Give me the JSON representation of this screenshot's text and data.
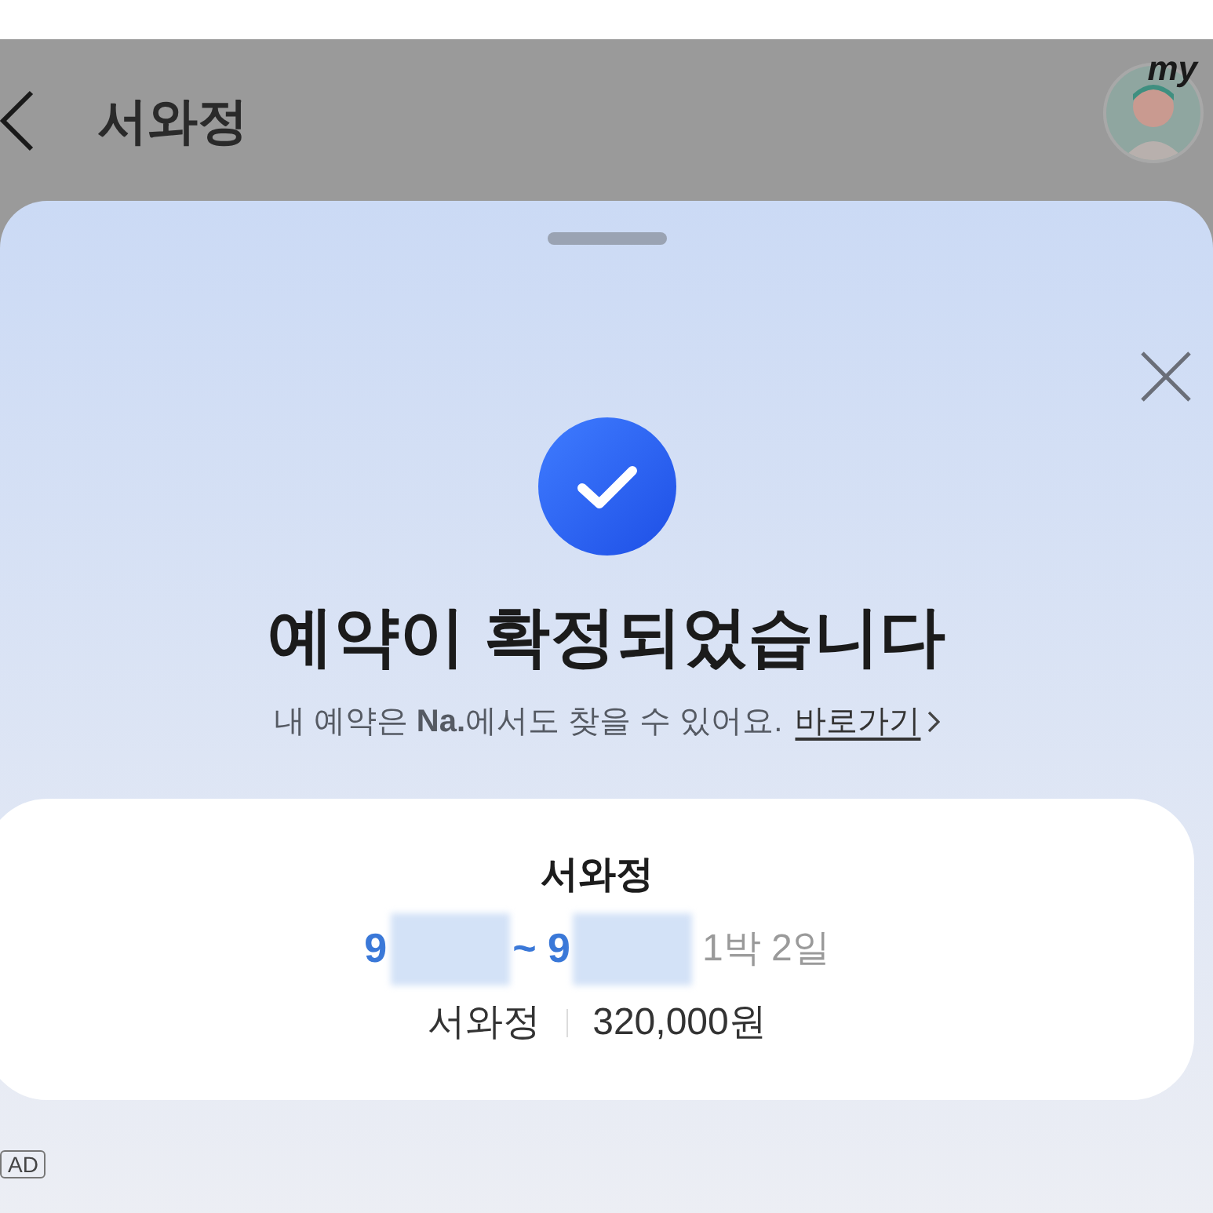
{
  "header": {
    "title": "서와정",
    "avatar_badge": "my"
  },
  "sheet": {
    "title": "예약이 확정되었습니다",
    "subtitle": "내 예약은 **Na.**에서도 찾을 수 있어요.",
    "link": "바로가기"
  },
  "booking": {
    "name": "서와정",
    "check_in": "9",
    "check_out": "~ 9",
    "nights": "1박 2일",
    "room": "서와정",
    "price": "320,000원"
  },
  "ad_badge": "AD"
}
